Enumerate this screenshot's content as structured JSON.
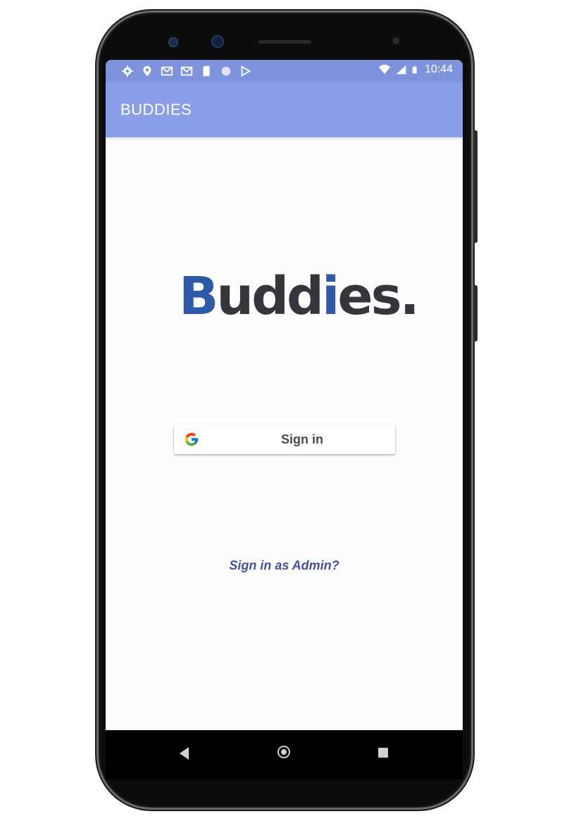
{
  "status_bar": {
    "time": "10:44",
    "left_icons": [
      "settings-icon",
      "location-icon",
      "gmail-icon",
      "gmail-icon",
      "sd-card-icon",
      "circle-icon",
      "play-store-icon"
    ],
    "right_icons": [
      "wifi-icon",
      "signal-icon",
      "battery-icon"
    ]
  },
  "app_bar": {
    "title": "BUDDIES"
  },
  "logo": {
    "text": "Buddies."
  },
  "sign_in_button": {
    "label": "Sign in",
    "icon": "google-g-icon"
  },
  "admin_link": {
    "label": "Sign in as Admin?"
  },
  "nav_bar": {
    "buttons": [
      "back-icon",
      "home-icon",
      "recents-icon"
    ]
  },
  "colors": {
    "app_bar": "#8a9ee8",
    "status_bar": "#7f93dd",
    "admin_link": "#3f51a5",
    "logo_dark": "#34363c",
    "logo_blue": "#2f5aa8"
  }
}
